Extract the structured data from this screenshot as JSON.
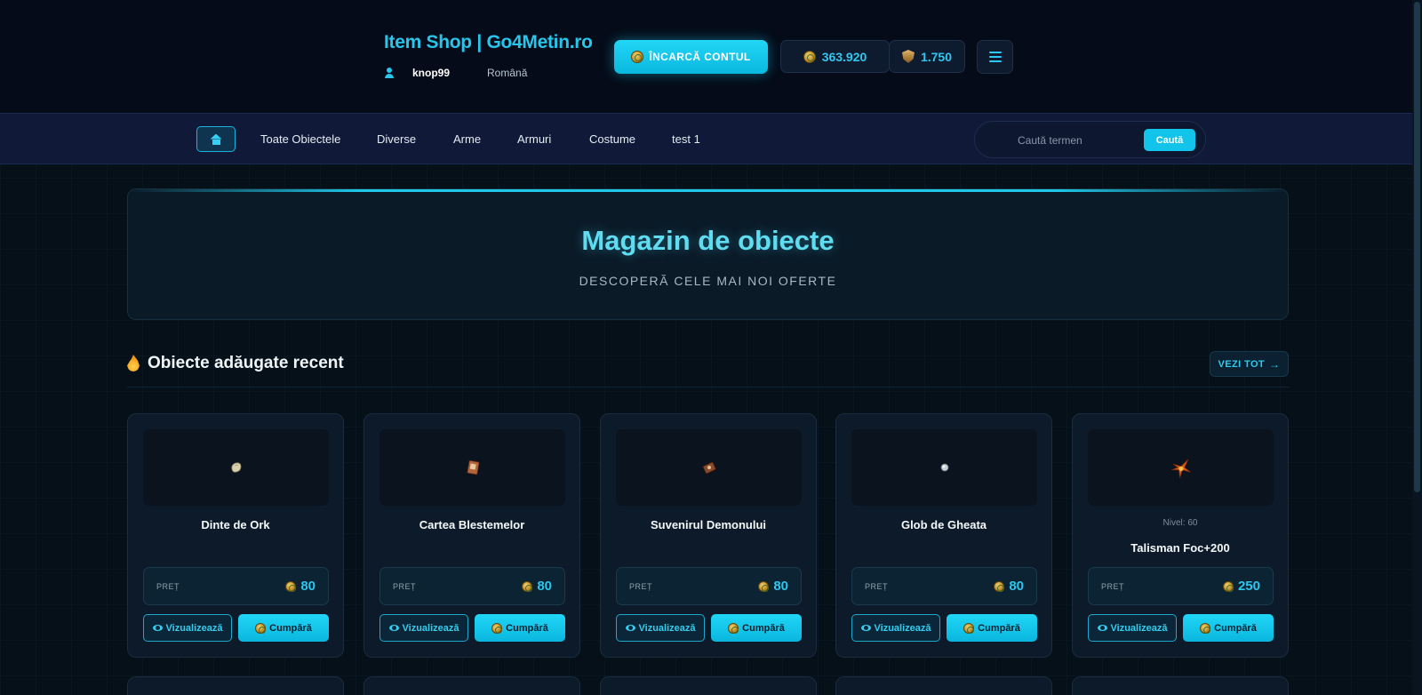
{
  "header": {
    "title": "Item Shop | Go4Metin.ro",
    "username": "knop99",
    "language": "Română",
    "load_account_label": "ÎNCARCĂ CONTUL",
    "coins_balance": "363.920",
    "shield_balance": "1.750"
  },
  "nav": {
    "items": [
      "Toate Obiectele",
      "Diverse",
      "Arme",
      "Armuri",
      "Costume",
      "test 1"
    ],
    "search_placeholder": "Caută termen",
    "search_button": "Caută"
  },
  "hero": {
    "title": "Magazin de obiecte",
    "subtitle": "DESCOPERĂ CELE MAI NOI OFERTE"
  },
  "recent": {
    "title": "Obiecte adăugate recent",
    "view_all": "VEZI TOT"
  },
  "labels": {
    "price": "PREȚ",
    "view": "Vizualizează",
    "buy": "Cumpără"
  },
  "items": [
    {
      "name": "Dinte de Ork",
      "price": "80",
      "level": ""
    },
    {
      "name": "Cartea Blestemelor",
      "price": "80",
      "level": ""
    },
    {
      "name": "Suvenirul Demonului",
      "price": "80",
      "level": ""
    },
    {
      "name": "Glob de Gheata",
      "price": "80",
      "level": ""
    },
    {
      "name": "Talisman Foc+200",
      "price": "250",
      "level": "Nivel: 60"
    }
  ],
  "colors": {
    "accent": "#13c4ea",
    "background": "#061019",
    "navbar": "#101a38"
  }
}
